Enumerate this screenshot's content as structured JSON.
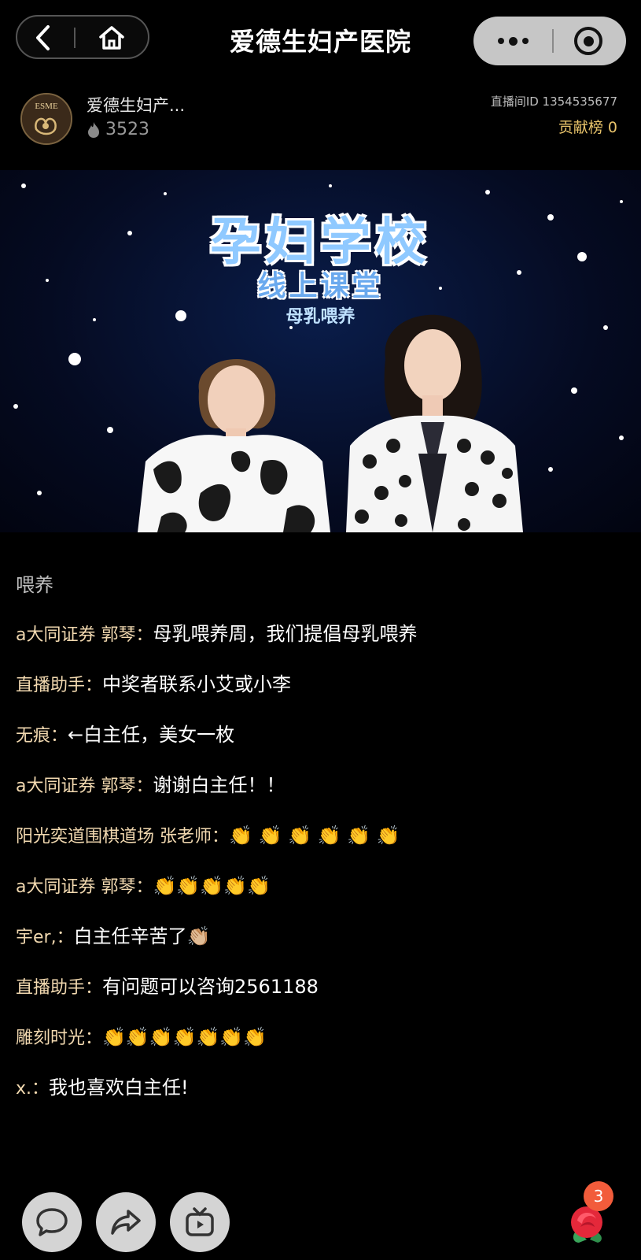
{
  "nav": {
    "title": "爱德生妇产医院"
  },
  "host": {
    "avatar_text": "ESME",
    "name": "爱德生妇产...",
    "heat": "3523",
    "room_id": "直播间ID 1354535677",
    "contribution": "贡献榜 0"
  },
  "video": {
    "title": "孕妇学校",
    "subtitle": "线上课堂",
    "topic": "母乳喂养"
  },
  "chat": {
    "first_line": "喂养",
    "messages": [
      {
        "user": "a大同证券 郭琴：",
        "text": "母乳喂养周，我们提倡母乳喂养"
      },
      {
        "user": "直播助手：",
        "text": "中奖者联系小艾或小李"
      },
      {
        "user": "无痕：",
        "text": "←白主任，美女一枚"
      },
      {
        "user": "a大同证券 郭琴：",
        "text": "谢谢白主任！！"
      },
      {
        "user": "阳光奕道围棋道场 张老师：",
        "text": "👏 👏 👏 👏 👏 👏"
      },
      {
        "user": "a大同证券 郭琴：",
        "text": "👏👏👏👏👏"
      },
      {
        "user": "宇er,：",
        "text": "白主任辛苦了👏🏼"
      },
      {
        "user": "直播助手：",
        "text": "有问题可以咨询2561188"
      },
      {
        "user": "雕刻时光：",
        "text": "👏👏👏👏👏👏👏"
      },
      {
        "user": "x.：",
        "text": "我也喜欢白主任!"
      }
    ]
  },
  "bottom": {
    "gift_badge": "3"
  },
  "colors": {
    "background": "#000000",
    "username": "#f2d9b0",
    "contribution": "#e8c36a",
    "badge": "#f25c3b"
  },
  "icons": [
    "back-icon",
    "home-icon",
    "more-icon",
    "close-icon",
    "flame-icon",
    "comment-icon",
    "share-icon",
    "tv-icon",
    "rose-icon"
  ]
}
